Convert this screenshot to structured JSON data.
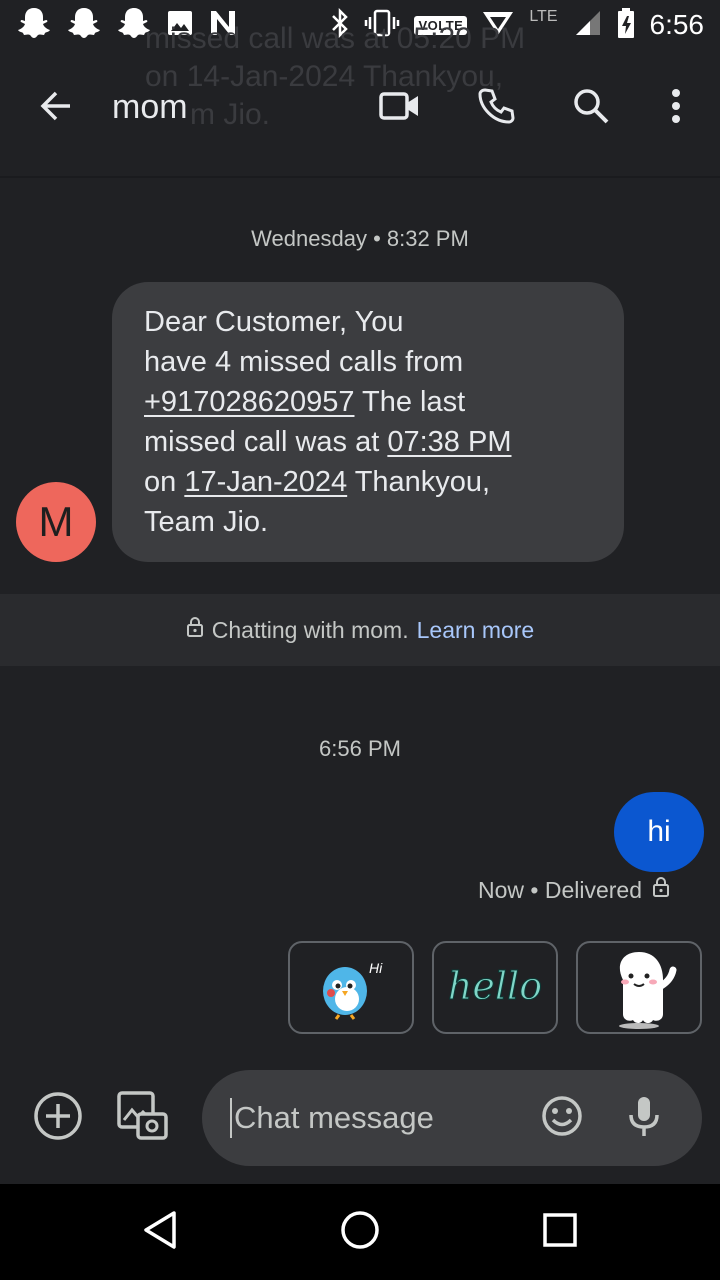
{
  "status_bar": {
    "time": "6:56",
    "volte": "VOLTE",
    "network": "LTE",
    "icons": [
      "snapchat-icon",
      "snapchat-icon",
      "snapchat-icon",
      "gallery-icon",
      "n-icon",
      "bluetooth-icon",
      "vibrate-icon",
      "hotspot-icon",
      "signal-icon",
      "battery-icon"
    ]
  },
  "header": {
    "contact_name": "mom",
    "actions": [
      "back-arrow-icon",
      "video-call-icon",
      "phone-icon",
      "search-icon",
      "more-vert-icon"
    ]
  },
  "conversation": {
    "first_date": "Wednesday • 8:32 PM",
    "incoming": {
      "avatar_letter": "M",
      "line1": "Dear Customer, You",
      "line2": "have 4 missed calls from",
      "phone_link": "+917028620957",
      "line3_rest": " The last",
      "line4_prefix": "missed call was at ",
      "time_link": "07:38 PM",
      "line5_prefix": "on ",
      "date_link": "17-Jan-2024",
      "line5_rest": " Thankyou,",
      "line6": "Team Jio."
    },
    "banner": {
      "text": "Chatting with mom.",
      "link": "Learn more"
    },
    "second_date": "6:56 PM",
    "outgoing": {
      "text": "hi",
      "status": "Now • Delivered"
    },
    "sticker_suggestions": [
      {
        "name": "bird-hi-sticker",
        "text": "Hi"
      },
      {
        "name": "hello-text-sticker",
        "text": "hello"
      },
      {
        "name": "ghost-wave-sticker",
        "text": ""
      }
    ]
  },
  "compose": {
    "placeholder": "Chat message"
  },
  "colors": {
    "background": "#202124",
    "incoming_bubble": "#3c3d40",
    "outgoing_bubble": "#0b57d0",
    "avatar": "#ee675c",
    "link": "#a8c7fa"
  }
}
